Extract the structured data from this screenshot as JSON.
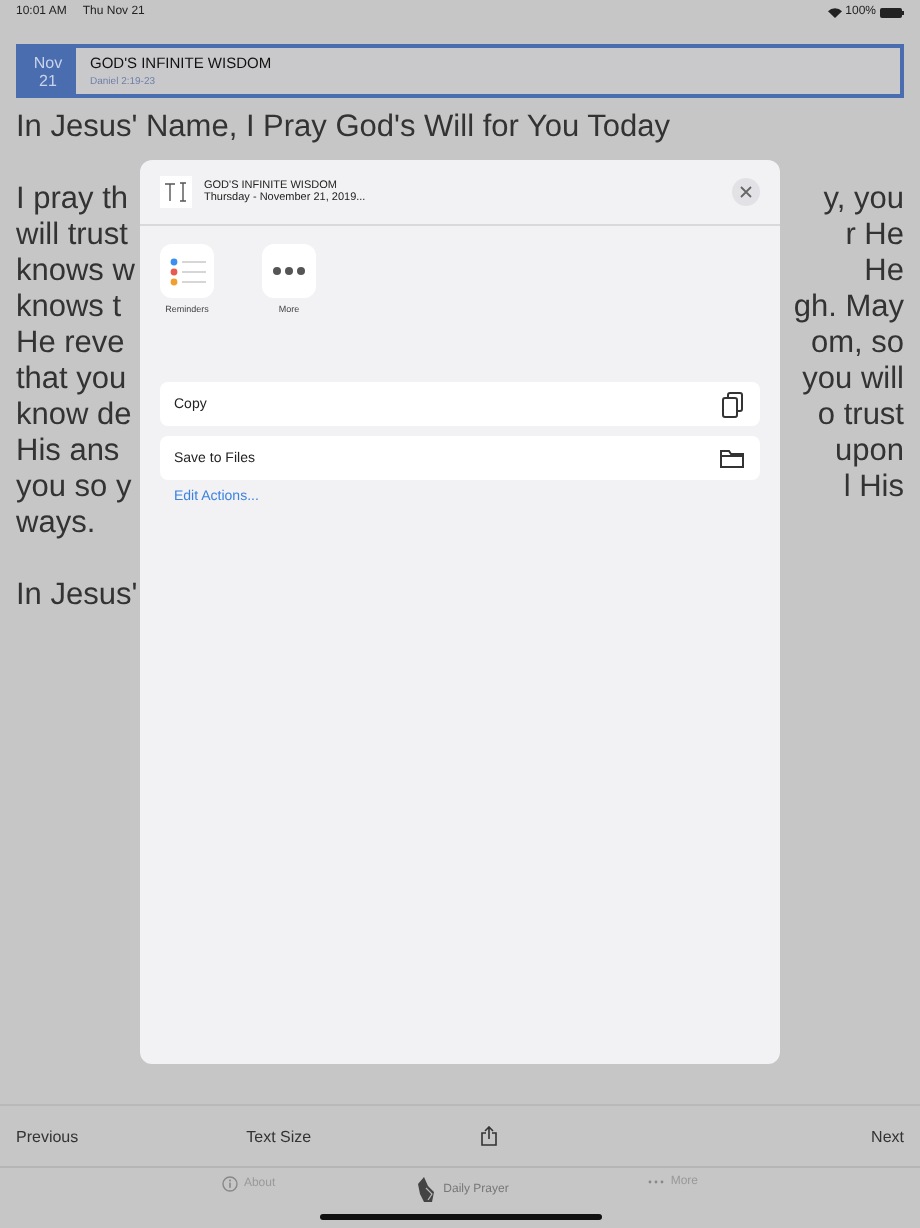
{
  "status_bar": {
    "time": "10:01 AM",
    "date": "Thu Nov 21",
    "battery": "100%"
  },
  "devotion": {
    "month": "Nov",
    "day": "21",
    "title": "GOD'S INFINITE WISDOM",
    "reference": "Daniel 2:19-23"
  },
  "heading": "In Jesus' Name, I Pray God's Will for You Today",
  "body_paragraphs": [
    {
      "lines": [
        {
          "left": "I pray th",
          "right": "y, you"
        },
        {
          "left": "will trust",
          "right": "r He"
        },
        {
          "left": "knows w",
          "right": "He"
        },
        {
          "left": "knows t",
          "right": "gh. May"
        },
        {
          "left": "He reve",
          "right": "om, so"
        },
        {
          "left": "that you",
          "right": "you will"
        },
        {
          "left": "know de",
          "right": "o trust"
        },
        {
          "left": "His ans",
          "right": "upon"
        },
        {
          "left": "you so y",
          "right": "l His"
        },
        {
          "left": "ways."
        }
      ]
    },
    {
      "lines": [
        {
          "left": "In Jesus'"
        }
      ]
    }
  ],
  "share_sheet": {
    "title": "GOD'S INFINITE WISDOM",
    "subtitle": "Thursday - November 21, 2019...",
    "apps": [
      {
        "kind": "reminders",
        "label": "Reminders"
      },
      {
        "kind": "more",
        "label": "More"
      }
    ],
    "actions": [
      {
        "kind": "copy",
        "label": "Copy"
      },
      {
        "kind": "files",
        "label": "Save to Files"
      }
    ],
    "edit_link": "Edit Actions..."
  },
  "toolbar": {
    "previous": "Previous",
    "text_size": "Text Size",
    "next": "Next"
  },
  "tabs": [
    {
      "kind": "about",
      "label": "About",
      "selected": false
    },
    {
      "kind": "prayer",
      "label": "Daily Prayer",
      "selected": true
    },
    {
      "kind": "more",
      "label": "More",
      "selected": false
    }
  ]
}
